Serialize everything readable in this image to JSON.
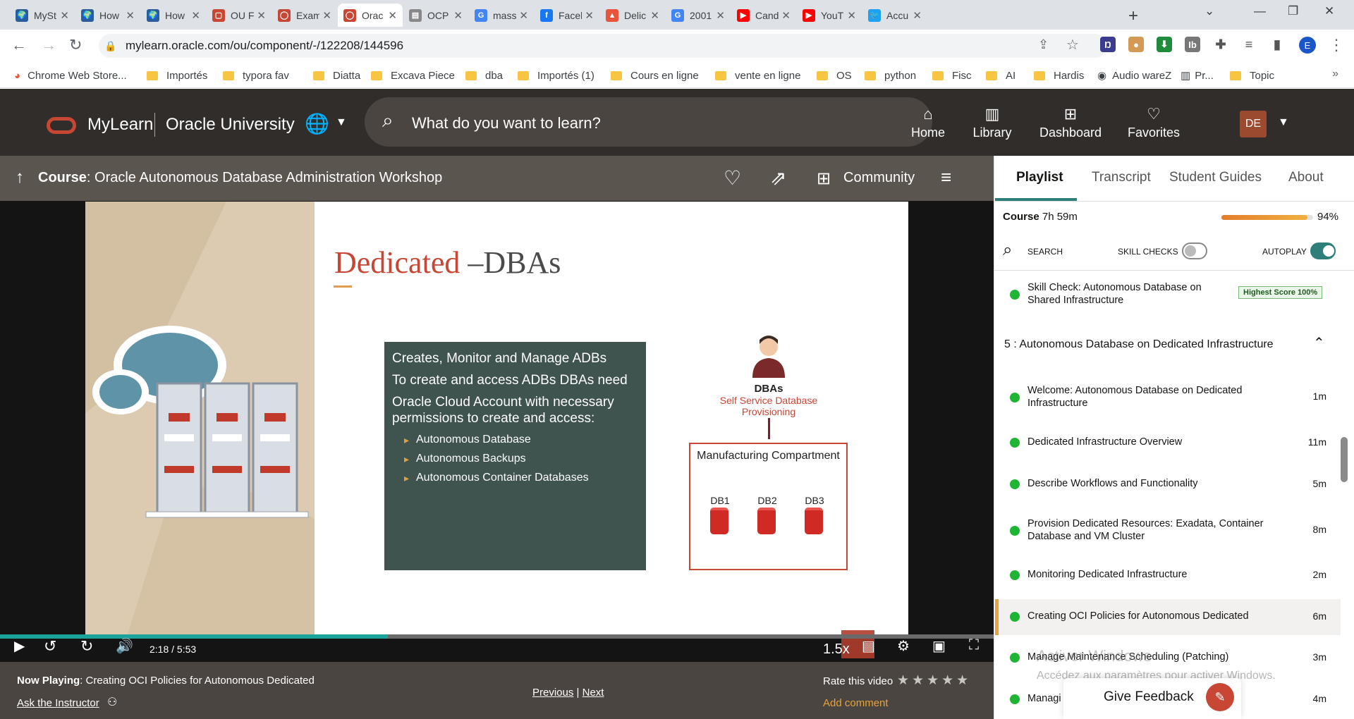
{
  "browser": {
    "tabs": [
      {
        "title": "MySt",
        "color": "#2a5d9c",
        "glyph": "🌍"
      },
      {
        "title": "How",
        "color": "#2a5d9c",
        "glyph": "🌍"
      },
      {
        "title": "How",
        "color": "#2a5d9c",
        "glyph": "🌍"
      },
      {
        "title": "OU F",
        "color": "#c74634",
        "glyph": "▢"
      },
      {
        "title": "Exam",
        "color": "#c74634",
        "glyph": "◯"
      },
      {
        "title": "Orac",
        "color": "#c74634",
        "glyph": "◯"
      },
      {
        "title": "OCP",
        "color": "#888888",
        "glyph": "▤"
      },
      {
        "title": "mass",
        "color": "#4285f4",
        "glyph": "G"
      },
      {
        "title": "Facel",
        "color": "#1877f2",
        "glyph": "f"
      },
      {
        "title": "Delic",
        "color": "#e8543c",
        "glyph": "▲"
      },
      {
        "title": "2001",
        "color": "#4285f4",
        "glyph": "G"
      },
      {
        "title": "Cand",
        "color": "#ff0000",
        "glyph": "▶"
      },
      {
        "title": "YouT",
        "color": "#ff0000",
        "glyph": "▶"
      },
      {
        "title": "Accu",
        "color": "#1da1f2",
        "glyph": "🐦"
      }
    ],
    "active_tab_index": 5,
    "url": "mylearn.oracle.com/ou/component/-/122208/144596",
    "profile_initial": "E",
    "bookmarks": [
      "Chrome Web Store...",
      "Importés",
      "typora fav",
      "Diatta",
      "Excava Piece",
      "dba",
      "Importés (1)",
      "Cours en ligne",
      "vente en ligne",
      "OS",
      "python",
      "Fisc",
      "AI",
      "Hardis",
      "Audio wareZ",
      "Pr...",
      "Topic"
    ]
  },
  "mylearn": {
    "brand": "MyLearn",
    "org": "Oracle University",
    "search_placeholder": "What do you want to learn?",
    "nav": [
      {
        "label": "Home",
        "icon": "home-icon",
        "glyph": "⌂"
      },
      {
        "label": "Library",
        "icon": "library-icon",
        "glyph": "▥"
      },
      {
        "label": "Dashboard",
        "icon": "dashboard-icon",
        "glyph": "⊞"
      },
      {
        "label": "Favorites",
        "icon": "favorites-icon",
        "glyph": "♡"
      }
    ],
    "avatar_initials": "DE"
  },
  "course": {
    "prefix": "Course",
    "title": ": Oracle Autonomous Database Administration Workshop",
    "community_label": "Community"
  },
  "slide": {
    "title_red": "Dedicated",
    "title_dark": " –DBAs",
    "box_lines": [
      "Creates, Monitor and Manage ADBs",
      "To create and access ADBs DBAs need",
      "Oracle Cloud Account with necessary permissions to create and access:"
    ],
    "bullets": [
      "Autonomous Database",
      "Autonomous Backups",
      "Autonomous Container Databases"
    ],
    "dba_label": "DBAs",
    "dba_sub": "Self Service Database Provisioning",
    "compartment": "Manufacturing Compartment",
    "dbs": [
      "DB1",
      "DB2",
      "DB3"
    ]
  },
  "player": {
    "time": "2:18  /  5:53",
    "progress": 0.39,
    "speed": "1.5x"
  },
  "now_playing": {
    "prefix": "Now Playing",
    "title": ": Creating OCI Policies for Autonomous Dedicated",
    "ask": "Ask the Instructor",
    "previous": "Previous",
    "sep": "|",
    "next": "Next",
    "rate_label": "Rate this video",
    "stars": "★★★★★",
    "add_comment": "Add comment"
  },
  "panel": {
    "tabs": [
      "Playlist",
      "Transcript",
      "Student Guides",
      "About"
    ],
    "course_prefix": "Course",
    "course_duration": " 7h 59m",
    "progress_pct": "94%",
    "progress_value": 0.94,
    "search_label": "SEARCH",
    "skill_checks_label": "SKILL CHECKS",
    "autoplay_label": "AUTOPLAY",
    "skill_check_item": "Skill Check: Autonomous Database on Shared Infrastructure",
    "highest_score": "Highest Score 100%",
    "section_title": "5 :  Autonomous Database on Dedicated Infrastructure",
    "items": [
      {
        "title": "Welcome: Autonomous Database on Dedicated Infrastructure",
        "dur": "1m"
      },
      {
        "title": "Dedicated Infrastructure Overview",
        "dur": "11m"
      },
      {
        "title": "Describe Workflows and Functionality",
        "dur": "5m"
      },
      {
        "title": "Provision Dedicated Resources: Exadata, Container Database and VM Cluster",
        "dur": "8m"
      },
      {
        "title": "Monitoring Dedicated Infrastructure",
        "dur": "2m"
      },
      {
        "title": "Creating OCI Policies for Autonomous Dedicated",
        "dur": "6m"
      },
      {
        "title": "Manage Maintenance Scheduling (Patching)",
        "dur": "3m"
      },
      {
        "title": "Managi",
        "dur": "4m"
      }
    ],
    "feedback_label": "Give Feedback"
  },
  "os_watermark": {
    "line1": "Activer Windows",
    "line2": "Accédez aux paramètres pour activer Windows."
  }
}
